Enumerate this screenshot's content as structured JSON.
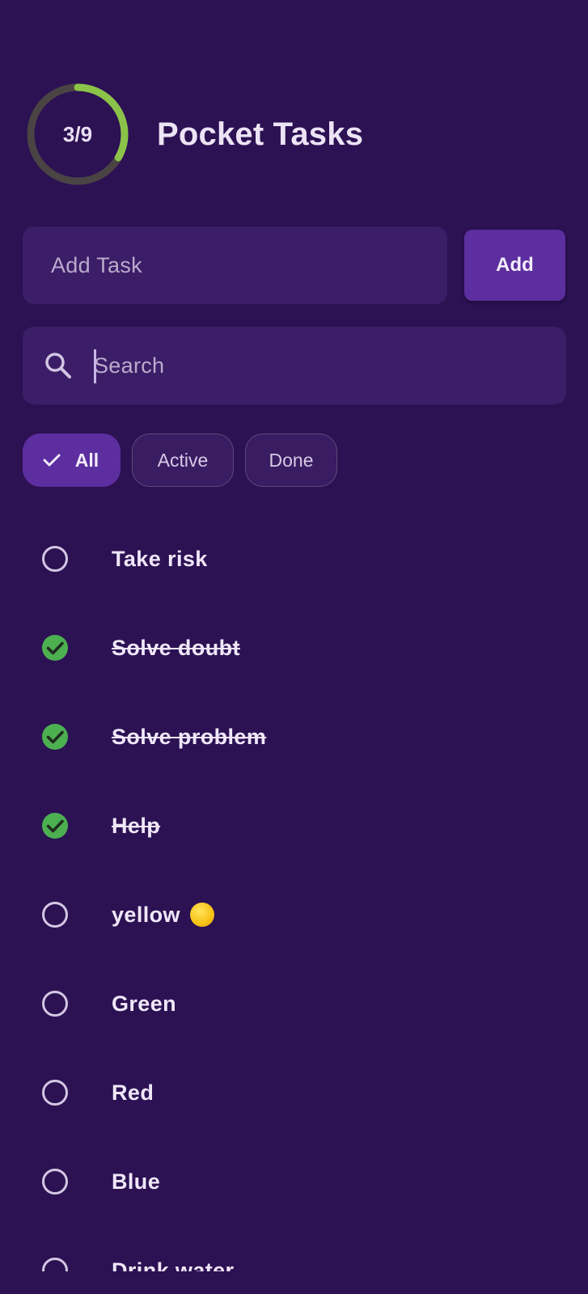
{
  "header": {
    "progress_label": "3/9",
    "progress_fraction": 0.333,
    "title": "Pocket Tasks",
    "progress_color": "#8bc34a",
    "progress_track_color": "#4a4444"
  },
  "add_task": {
    "placeholder": "Add Task",
    "button_label": "Add"
  },
  "search": {
    "placeholder": "Search",
    "icon": "search-icon"
  },
  "filters": [
    {
      "label": "All",
      "selected": true,
      "icon": "check-icon"
    },
    {
      "label": "Active",
      "selected": false
    },
    {
      "label": "Done",
      "selected": false
    }
  ],
  "tasks": [
    {
      "label": "Take risk",
      "done": false
    },
    {
      "label": "Solve doubt",
      "done": true
    },
    {
      "label": "Solve problem",
      "done": true
    },
    {
      "label": "Help",
      "done": true
    },
    {
      "label": "yellow",
      "done": false,
      "emoji": "yellow-circle-emoji"
    },
    {
      "label": "Green",
      "done": false
    },
    {
      "label": "Red",
      "done": false
    },
    {
      "label": "Blue",
      "done": false
    },
    {
      "label": "Drink water",
      "done": false
    }
  ],
  "colors": {
    "background": "#2c1153",
    "surface": "#3c1d67",
    "accent": "#5c2e9f",
    "done_check": "#4caf50"
  }
}
